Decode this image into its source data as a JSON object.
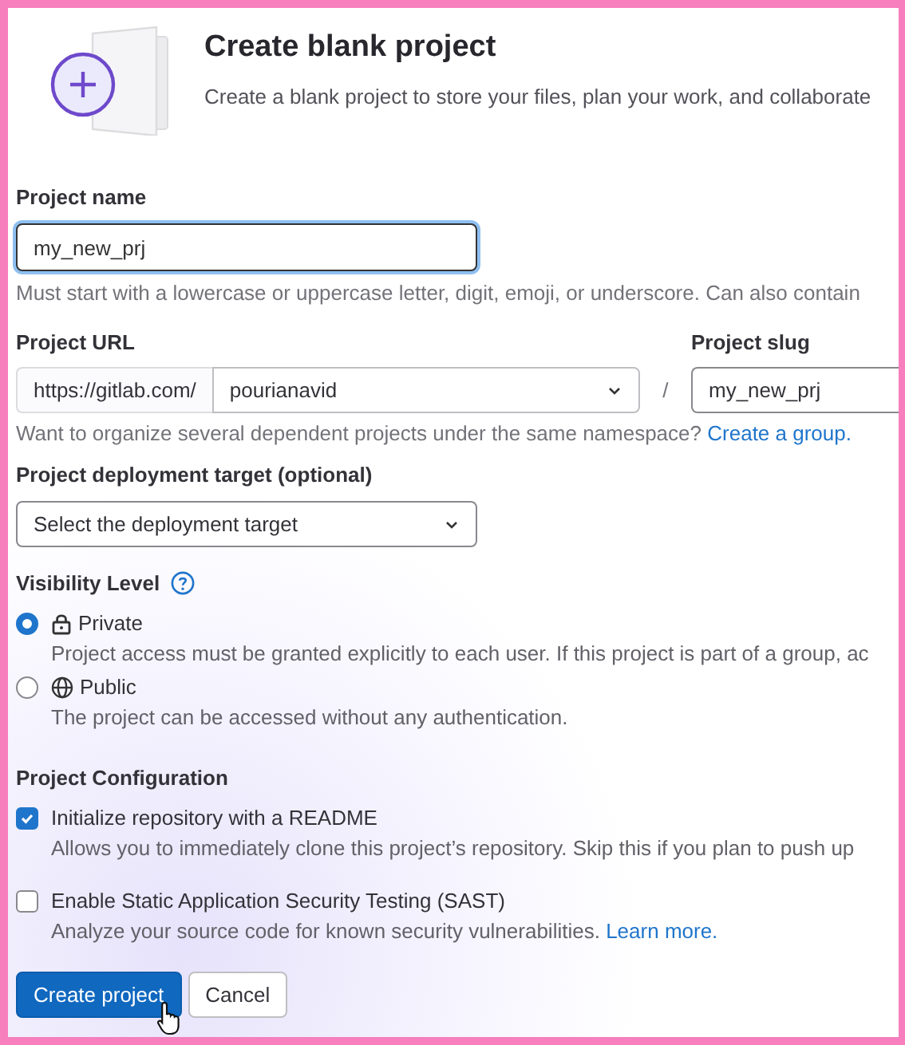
{
  "header": {
    "title": "Create blank project",
    "description": "Create a blank project to store your files, plan your work, and collaborate"
  },
  "project_name": {
    "label": "Project name",
    "value": "my_new_prj",
    "help": "Must start with a lowercase or uppercase letter, digit, emoji, or underscore. Can also contain"
  },
  "project_url": {
    "label": "Project URL",
    "prefix": "https://gitlab.com/",
    "namespace": "pourianavid",
    "separator": "/",
    "help": "Want to organize several dependent projects under the same namespace?",
    "help_link": "Create a group."
  },
  "project_slug": {
    "label": "Project slug",
    "value": "my_new_prj"
  },
  "deployment_target": {
    "label": "Project deployment target (optional)",
    "value": "Select the deployment target"
  },
  "visibility": {
    "label": "Visibility Level",
    "options": [
      {
        "kind": "private",
        "label": "Private",
        "description": "Project access must be granted explicitly to each user. If this project is part of a group, ac",
        "selected": true
      },
      {
        "kind": "public",
        "label": "Public",
        "description": "The project can be accessed without any authentication.",
        "selected": false
      }
    ]
  },
  "configuration": {
    "label": "Project Configuration",
    "options": [
      {
        "label": "Initialize repository with a README",
        "description": "Allows you to immediately clone this project’s repository. Skip this if you plan to push up",
        "checked": true
      },
      {
        "label": "Enable Static Application Security Testing (SAST)",
        "description": "Analyze your source code for known security vulnerabilities.",
        "link": "Learn more.",
        "checked": false
      }
    ]
  },
  "buttons": [
    {
      "kind": "primary",
      "label": "Create project"
    },
    {
      "kind": "secondary",
      "label": "Cancel"
    }
  ]
}
